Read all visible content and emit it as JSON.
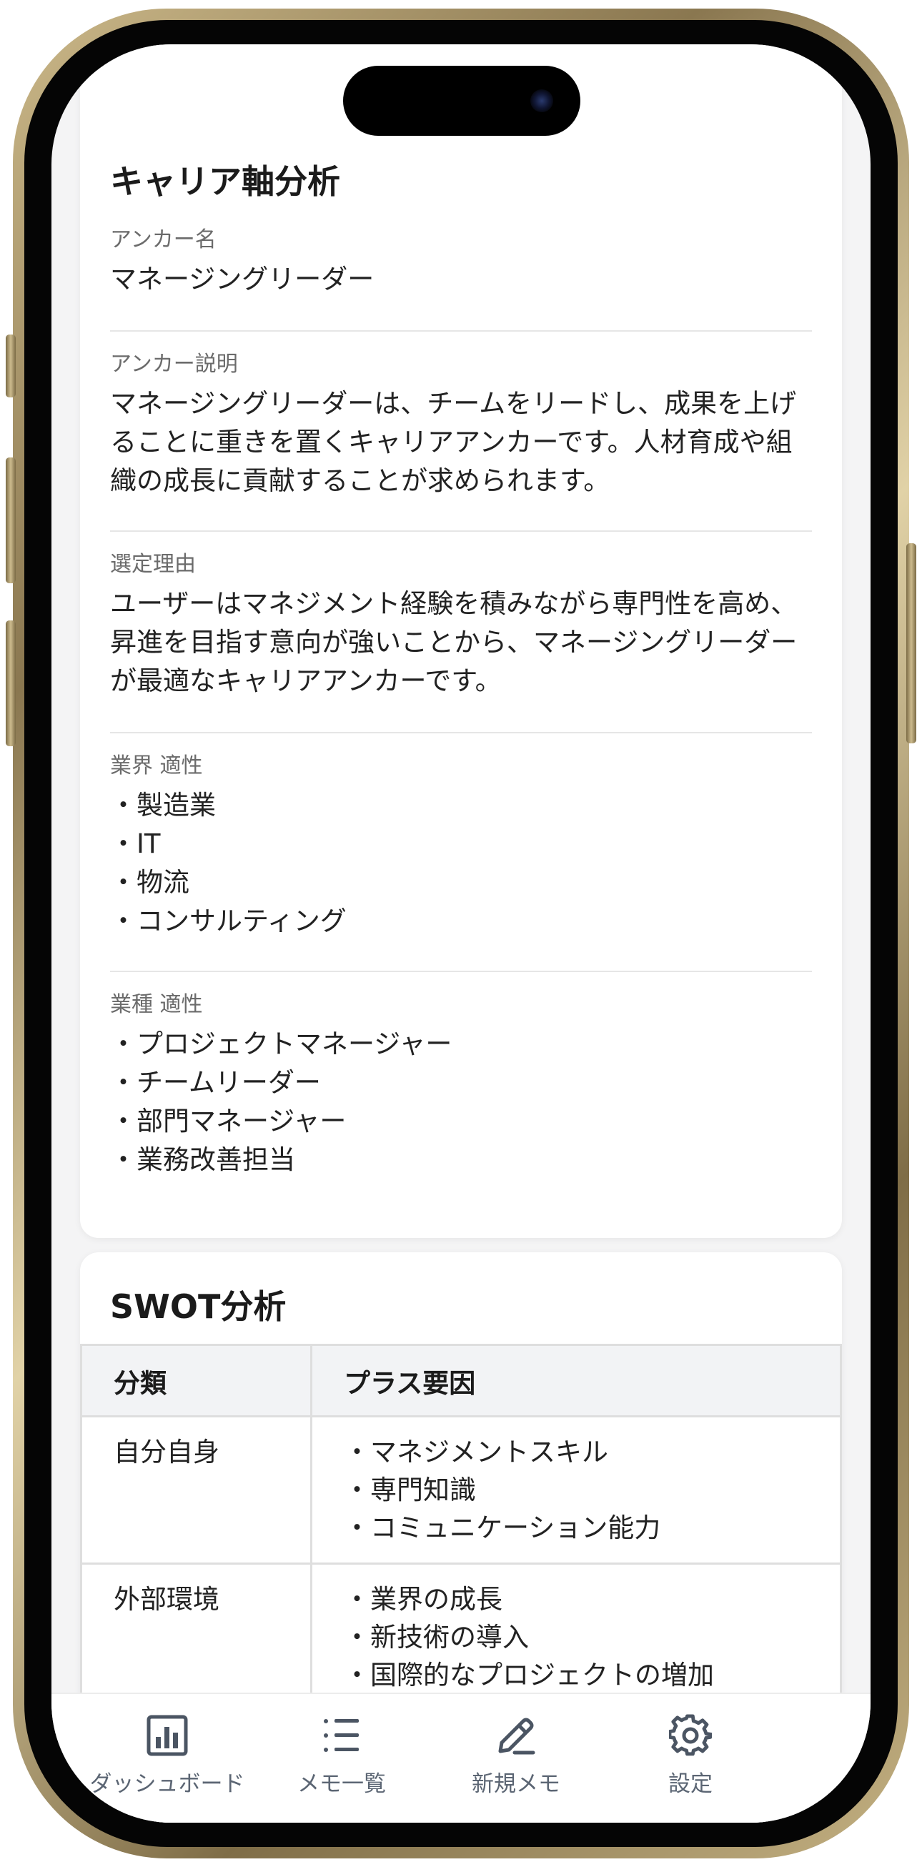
{
  "career_analysis": {
    "title": "キャリア軸分析",
    "anchor_name": {
      "label": "アンカー名",
      "value": "マネージングリーダー"
    },
    "anchor_description": {
      "label": "アンカー説明",
      "lines": [
        "マネージングリーダーは、チームをリードし、成果を上げ",
        "ることに重きを置くキャリアアンカーです。人材育成や組",
        "織の成長に貢献することが求められます。"
      ]
    },
    "selection_reason": {
      "label": "選定理由",
      "lines": [
        "ユーザーはマネジメント経験を積みながら専門性を高め、",
        "昇進を目指す意向が強いことから、マネージングリーダー",
        "が最適なキャリアアンカーです。"
      ]
    },
    "industry_fit": {
      "label": "業界 適性",
      "items": [
        "・製造業",
        "・IT",
        "・物流",
        "・コンサルティング"
      ]
    },
    "job_fit": {
      "label": "業種 適性",
      "items": [
        "・プロジェクトマネージャー",
        "・チームリーダー",
        "・部門マネージャー",
        "・業務改善担当"
      ]
    }
  },
  "swot": {
    "title": "SWOT分析",
    "headers": [
      "分類",
      "プラス要因"
    ],
    "rows": [
      {
        "category": "自分自身",
        "items": [
          "・マネジメントスキル",
          "・専門知識",
          "・コミュニケーション能力"
        ]
      },
      {
        "category": "外部環境",
        "items": [
          "・業界の成長",
          "・新技術の導入",
          "・国際的なプロジェクトの増加"
        ]
      }
    ]
  },
  "tabbar": {
    "items": [
      {
        "label": "ダッシュボード",
        "icon": "dashboard-icon"
      },
      {
        "label": "メモ一覧",
        "icon": "list-icon"
      },
      {
        "label": "新規メモ",
        "icon": "pencil-icon"
      },
      {
        "label": "設定",
        "icon": "gear-icon"
      }
    ],
    "icon_color": "#4b5563"
  }
}
